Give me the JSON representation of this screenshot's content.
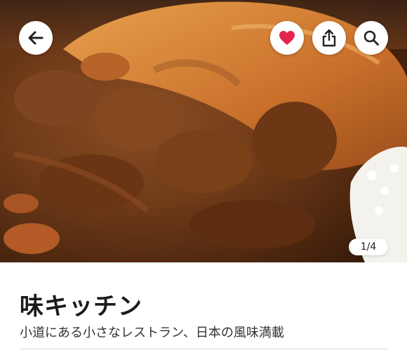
{
  "hero": {
    "image_description_icon": "food-photo",
    "counter": "1/4"
  },
  "toolbar": {
    "back_icon": "back-arrow-icon",
    "favorite_icon": "heart-icon",
    "share_icon": "share-icon",
    "search_icon": "search-icon"
  },
  "restaurant": {
    "name": "味キッチン",
    "tagline": "小道にある小さなレストラン、日本の風味満載"
  },
  "colors": {
    "heart": "#e5254b",
    "icon": "#222222"
  }
}
